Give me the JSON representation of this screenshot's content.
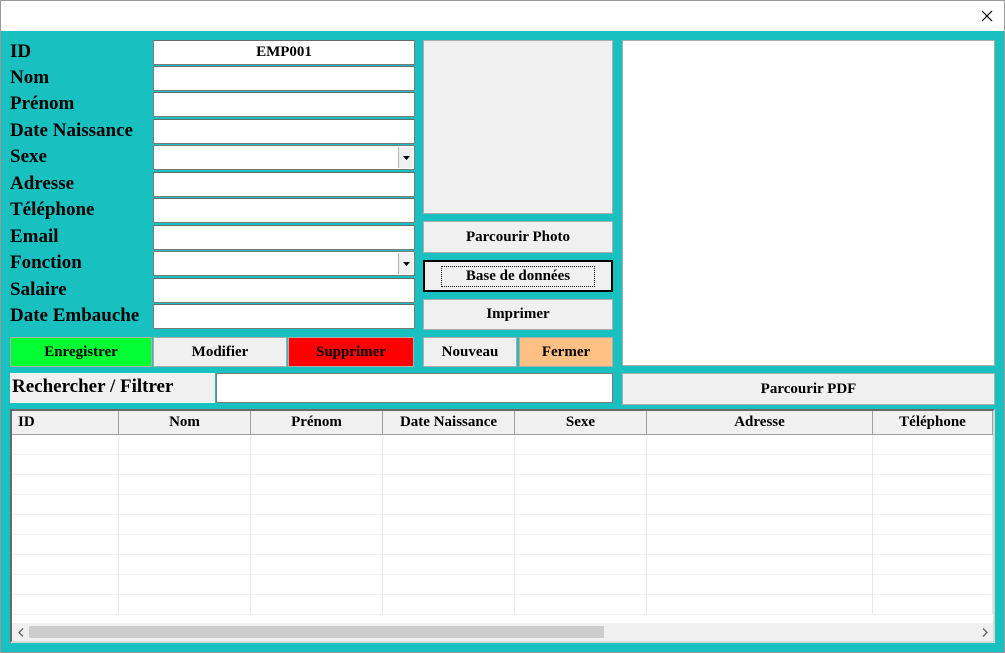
{
  "window": {
    "close_glyph": "✕"
  },
  "form": {
    "labels": [
      "ID",
      "Nom",
      "Prénom",
      "Date Naissance",
      "Sexe",
      "Adresse",
      "Téléphone",
      "Email",
      "Fonction",
      "Salaire",
      "Date Embauche"
    ],
    "id_value": "EMP001"
  },
  "buttons": {
    "browse_photo": "Parcourir Photo",
    "database": "Base de données",
    "print": "Imprimer",
    "save": "Enregistrer",
    "modify": "Modifier",
    "delete": "Supprimer",
    "new": "Nouveau",
    "close": "Fermer",
    "browse_pdf": "Parcourir PDF"
  },
  "search": {
    "label": "Rechercher / Filtrer",
    "value": ""
  },
  "grid": {
    "columns": [
      "ID",
      "Nom",
      "Prénom",
      "Date Naissance",
      "Sexe",
      "Adresse",
      "Téléphone"
    ],
    "rows": []
  },
  "colors": {
    "background": "#18c1bf",
    "save": "#00ff33",
    "delete": "#ff0000",
    "close": "#ffc083",
    "control": "#f0f0f0"
  },
  "icons": {
    "close": "close-icon",
    "dropdown": "chevron-down-icon",
    "scroll_left": "chevron-left-icon",
    "scroll_right": "chevron-right-icon"
  }
}
